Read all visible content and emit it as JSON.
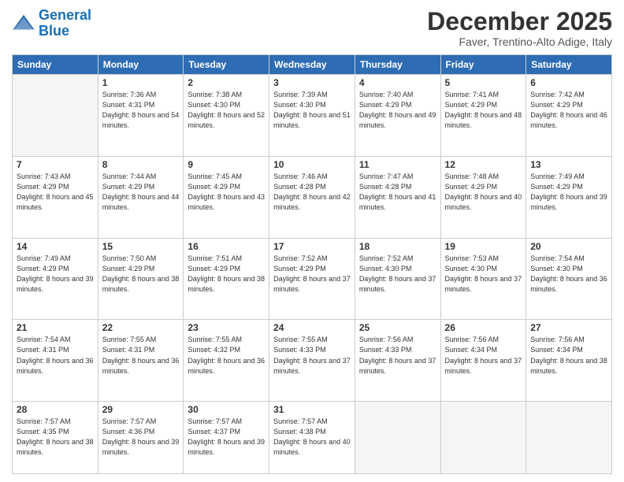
{
  "logo": {
    "line1": "General",
    "line2": "Blue"
  },
  "title": "December 2025",
  "subtitle": "Faver, Trentino-Alto Adige, Italy",
  "days_of_week": [
    "Sunday",
    "Monday",
    "Tuesday",
    "Wednesday",
    "Thursday",
    "Friday",
    "Saturday"
  ],
  "weeks": [
    [
      {
        "day": "",
        "info": ""
      },
      {
        "day": "1",
        "info": "Sunrise: 7:36 AM\nSunset: 4:31 PM\nDaylight: 8 hours\nand 54 minutes."
      },
      {
        "day": "2",
        "info": "Sunrise: 7:38 AM\nSunset: 4:30 PM\nDaylight: 8 hours\nand 52 minutes."
      },
      {
        "day": "3",
        "info": "Sunrise: 7:39 AM\nSunset: 4:30 PM\nDaylight: 8 hours\nand 51 minutes."
      },
      {
        "day": "4",
        "info": "Sunrise: 7:40 AM\nSunset: 4:29 PM\nDaylight: 8 hours\nand 49 minutes."
      },
      {
        "day": "5",
        "info": "Sunrise: 7:41 AM\nSunset: 4:29 PM\nDaylight: 8 hours\nand 48 minutes."
      },
      {
        "day": "6",
        "info": "Sunrise: 7:42 AM\nSunset: 4:29 PM\nDaylight: 8 hours\nand 46 minutes."
      }
    ],
    [
      {
        "day": "7",
        "info": "Sunrise: 7:43 AM\nSunset: 4:29 PM\nDaylight: 8 hours\nand 45 minutes."
      },
      {
        "day": "8",
        "info": "Sunrise: 7:44 AM\nSunset: 4:29 PM\nDaylight: 8 hours\nand 44 minutes."
      },
      {
        "day": "9",
        "info": "Sunrise: 7:45 AM\nSunset: 4:29 PM\nDaylight: 8 hours\nand 43 minutes."
      },
      {
        "day": "10",
        "info": "Sunrise: 7:46 AM\nSunset: 4:28 PM\nDaylight: 8 hours\nand 42 minutes."
      },
      {
        "day": "11",
        "info": "Sunrise: 7:47 AM\nSunset: 4:28 PM\nDaylight: 8 hours\nand 41 minutes."
      },
      {
        "day": "12",
        "info": "Sunrise: 7:48 AM\nSunset: 4:29 PM\nDaylight: 8 hours\nand 40 minutes."
      },
      {
        "day": "13",
        "info": "Sunrise: 7:49 AM\nSunset: 4:29 PM\nDaylight: 8 hours\nand 39 minutes."
      }
    ],
    [
      {
        "day": "14",
        "info": "Sunrise: 7:49 AM\nSunset: 4:29 PM\nDaylight: 8 hours\nand 39 minutes."
      },
      {
        "day": "15",
        "info": "Sunrise: 7:50 AM\nSunset: 4:29 PM\nDaylight: 8 hours\nand 38 minutes."
      },
      {
        "day": "16",
        "info": "Sunrise: 7:51 AM\nSunset: 4:29 PM\nDaylight: 8 hours\nand 38 minutes."
      },
      {
        "day": "17",
        "info": "Sunrise: 7:52 AM\nSunset: 4:29 PM\nDaylight: 8 hours\nand 37 minutes."
      },
      {
        "day": "18",
        "info": "Sunrise: 7:52 AM\nSunset: 4:30 PM\nDaylight: 8 hours\nand 37 minutes."
      },
      {
        "day": "19",
        "info": "Sunrise: 7:53 AM\nSunset: 4:30 PM\nDaylight: 8 hours\nand 37 minutes."
      },
      {
        "day": "20",
        "info": "Sunrise: 7:54 AM\nSunset: 4:30 PM\nDaylight: 8 hours\nand 36 minutes."
      }
    ],
    [
      {
        "day": "21",
        "info": "Sunrise: 7:54 AM\nSunset: 4:31 PM\nDaylight: 8 hours\nand 36 minutes."
      },
      {
        "day": "22",
        "info": "Sunrise: 7:55 AM\nSunset: 4:31 PM\nDaylight: 8 hours\nand 36 minutes."
      },
      {
        "day": "23",
        "info": "Sunrise: 7:55 AM\nSunset: 4:32 PM\nDaylight: 8 hours\nand 36 minutes."
      },
      {
        "day": "24",
        "info": "Sunrise: 7:55 AM\nSunset: 4:33 PM\nDaylight: 8 hours\nand 37 minutes."
      },
      {
        "day": "25",
        "info": "Sunrise: 7:56 AM\nSunset: 4:33 PM\nDaylight: 8 hours\nand 37 minutes."
      },
      {
        "day": "26",
        "info": "Sunrise: 7:56 AM\nSunset: 4:34 PM\nDaylight: 8 hours\nand 37 minutes."
      },
      {
        "day": "27",
        "info": "Sunrise: 7:56 AM\nSunset: 4:34 PM\nDaylight: 8 hours\nand 38 minutes."
      }
    ],
    [
      {
        "day": "28",
        "info": "Sunrise: 7:57 AM\nSunset: 4:35 PM\nDaylight: 8 hours\nand 38 minutes."
      },
      {
        "day": "29",
        "info": "Sunrise: 7:57 AM\nSunset: 4:36 PM\nDaylight: 8 hours\nand 39 minutes."
      },
      {
        "day": "30",
        "info": "Sunrise: 7:57 AM\nSunset: 4:37 PM\nDaylight: 8 hours\nand 39 minutes."
      },
      {
        "day": "31",
        "info": "Sunrise: 7:57 AM\nSunset: 4:38 PM\nDaylight: 8 hours\nand 40 minutes."
      },
      {
        "day": "",
        "info": ""
      },
      {
        "day": "",
        "info": ""
      },
      {
        "day": "",
        "info": ""
      }
    ]
  ]
}
